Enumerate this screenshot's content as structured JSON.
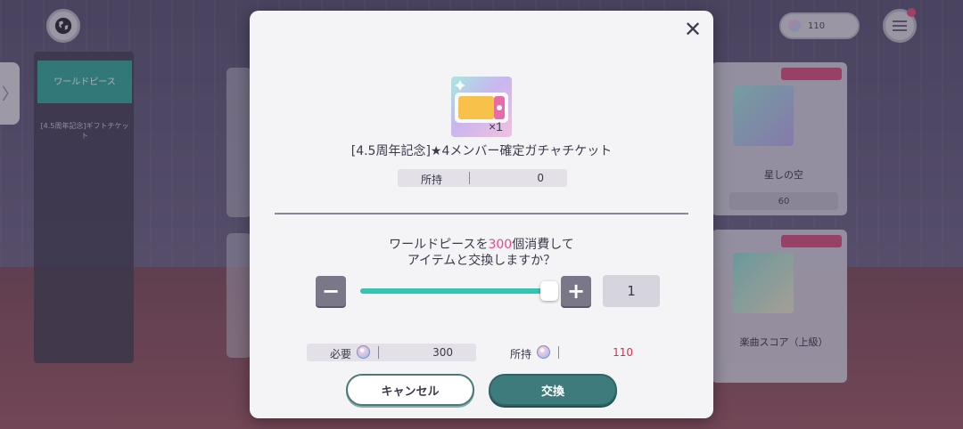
{
  "background": {
    "side_tab_glyph": "〉",
    "left_menu": {
      "active_item": "ワールドピース",
      "item": "[4.5周年記念]ギフトチケット"
    },
    "cards": [
      {
        "name": "星しの空",
        "price": "60"
      },
      {
        "name": "楽曲スコア（上級）",
        "price": ""
      }
    ],
    "currency_amount": "110"
  },
  "modal": {
    "close_glyph": "✕",
    "ticket": {
      "icon": "gacha-ticket-icon",
      "quantity": "×1",
      "title": "[4.5周年記念]★4メンバー確定ガチャチケット"
    },
    "owned": {
      "label": "所持",
      "value": "0"
    },
    "confirm": {
      "prefix": "ワールドピースを",
      "amount": "300",
      "suffix": "個消費して",
      "line2": "アイテムと交換しますか？"
    },
    "stepper": {
      "minus": "−",
      "plus": "+",
      "value": "1",
      "slider_fraction": 1.0
    },
    "cost": {
      "label": "必要",
      "icon": "world-piece-icon",
      "value": "300"
    },
    "have": {
      "label": "所持",
      "icon": "world-piece-icon",
      "value": "110"
    },
    "buttons": {
      "cancel": "キャンセル",
      "exchange": "交換"
    }
  }
}
